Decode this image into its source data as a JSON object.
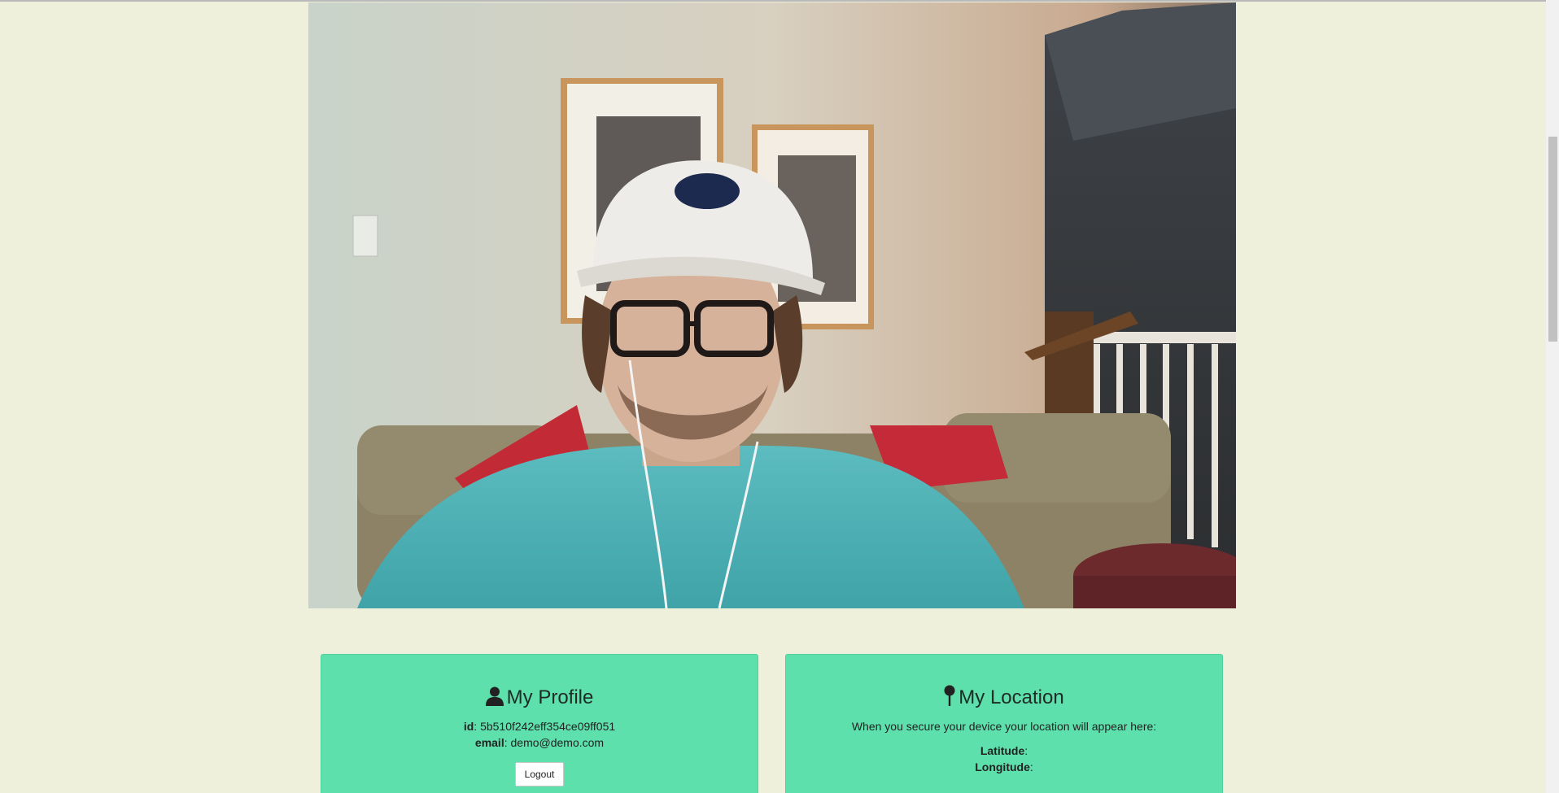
{
  "webcam": {
    "description_name": "webcam-feed"
  },
  "profile": {
    "title": "My Profile",
    "icon": "user-icon",
    "id_label": "id",
    "id_value": "5b510f242eff354ce09ff051",
    "email_label": "email",
    "email_value": "demo@demo.com",
    "logout_label": "Logout"
  },
  "location": {
    "title": "My Location",
    "icon": "map-pin-icon",
    "description": "When you secure your device your location will appear here:",
    "latitude_label": "Latitude",
    "latitude_value": "",
    "longitude_label": "Longitude",
    "longitude_value": ""
  },
  "colors": {
    "page_background": "#eef0dc",
    "panel_background": "#5de0ab"
  }
}
